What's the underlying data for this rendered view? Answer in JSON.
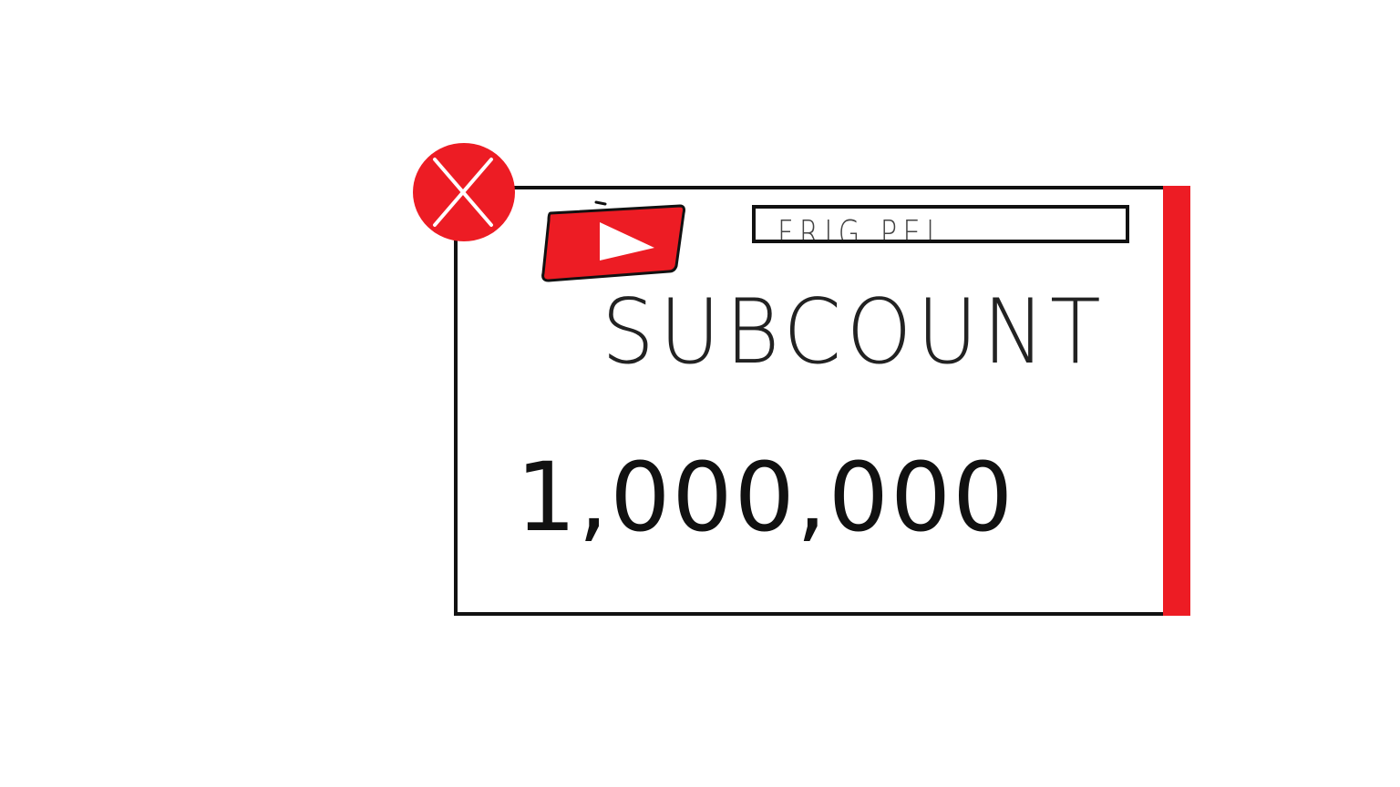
{
  "widget": {
    "channel_name": "FRIG PEI",
    "title": "SUBCOUNT",
    "count": "1,000,000"
  },
  "icons": {
    "close": "close-icon",
    "logo": "youtube-play-icon"
  },
  "colors": {
    "accent": "#ed1c24",
    "border": "#111111",
    "background": "#ffffff"
  }
}
